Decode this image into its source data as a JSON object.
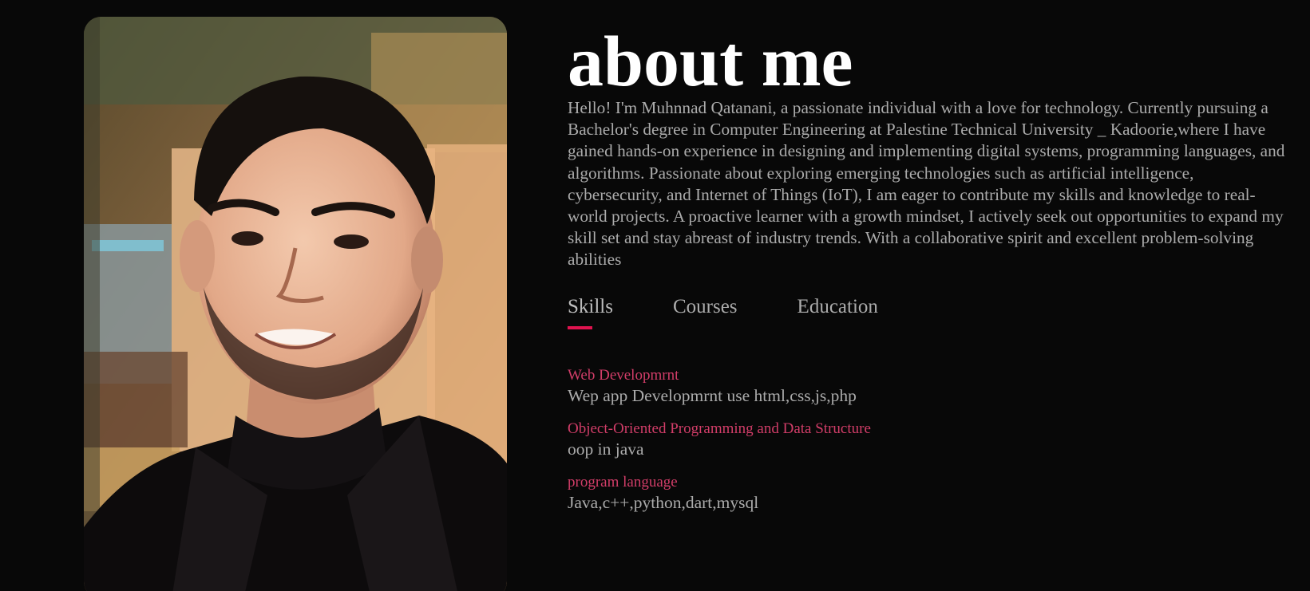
{
  "photo": {
    "alt": "Portrait photo"
  },
  "about": {
    "title": "about me",
    "bio": "Hello! I'm Muhnnad Qatanani, a passionate individual with a love for technology. Currently pursuing a Bachelor's degree in Computer Engineering at Palestine Technical University _ Kadoorie,where I have gained hands-on experience in designing and implementing digital systems, programming languages, and algorithms. Passionate about exploring emerging technologies such as artificial intelligence, cybersecurity, and Internet of Things (IoT), I am eager to contribute my skills and knowledge to real-world projects. A proactive learner with a growth mindset, I actively seek out opportunities to expand my skill set and stay abreast of industry trends. With a collaborative spirit and excellent problem-solving abilities"
  },
  "tabs": [
    {
      "label": "Skills",
      "active": true
    },
    {
      "label": "Courses",
      "active": false
    },
    {
      "label": "Education",
      "active": false
    }
  ],
  "skills": [
    {
      "title": "Web Developmrnt",
      "desc": "Wep app Developmrnt use html,css,js,php"
    },
    {
      "title": "Object-Oriented Programming and Data Structure",
      "desc": "oop in java"
    },
    {
      "title": "program language",
      "desc": "Java,c++,python,dart,mysql"
    }
  ],
  "colors": {
    "background": "#080808",
    "accent": "#e0134f",
    "skill_title": "#d13d68",
    "text": "#ababab",
    "heading": "#ffffff"
  }
}
